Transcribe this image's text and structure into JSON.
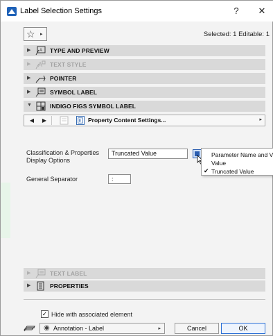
{
  "window": {
    "title": "Label Selection Settings",
    "help_glyph": "?",
    "close_glyph": "✕"
  },
  "toolbar": {
    "favorites_glyph": "☆",
    "favorites_arrow": "▸",
    "selection_info": "Selected: 1 Editable: 1"
  },
  "panels": [
    {
      "label": "TYPE AND PREVIEW",
      "chevron": "▶",
      "enabled": true,
      "icon": "type-preview-icon"
    },
    {
      "label": "TEXT STYLE",
      "chevron": "▶",
      "enabled": false,
      "icon": "text-style-icon"
    },
    {
      "label": "POINTER",
      "chevron": "▶",
      "enabled": true,
      "icon": "pointer-icon"
    },
    {
      "label": "SYMBOL LABEL",
      "chevron": "▶",
      "enabled": true,
      "icon": "symbol-label-icon"
    },
    {
      "label": "INDIGO FIGS SYMBOL LABEL",
      "chevron": "▼",
      "enabled": true,
      "expanded": true,
      "icon": "addon-label-icon"
    },
    {
      "label": "TEXT LABEL",
      "chevron": "▶",
      "enabled": false,
      "icon": "text-label-icon"
    },
    {
      "label": "PROPERTIES",
      "chevron": "▶",
      "enabled": true,
      "icon": "properties-icon"
    }
  ],
  "page_nav": {
    "prev_glyph": "◀",
    "next_glyph": "▶",
    "page_label": "Property Content Settings...",
    "arrow_glyph": "▸"
  },
  "form": {
    "classification_label": "Classification & Properties Display Options",
    "classification_value": "Truncated Value",
    "separator_label": "General Separator",
    "separator_value": ":"
  },
  "dropdown_menu": {
    "items": [
      {
        "label": "Parameter Name and Value",
        "checked": false
      },
      {
        "label": "Value",
        "checked": false
      },
      {
        "label": "Truncated Value",
        "checked": true
      }
    ],
    "check_glyph": "✔"
  },
  "footer": {
    "hide_label": "Hide with associated element",
    "hide_checked": true,
    "check_glyph": "✓",
    "layer_eye_glyph": "◉",
    "layer_value": "Annotation - Label",
    "layer_arrow": "▸",
    "cancel_label": "Cancel",
    "ok_label": "OK"
  },
  "colors": {
    "accent": "#2a5db0",
    "panel_bg": "#d9d9d9",
    "dialog_bg": "#f3f3f3",
    "ok_border": "#2a6fd6"
  }
}
